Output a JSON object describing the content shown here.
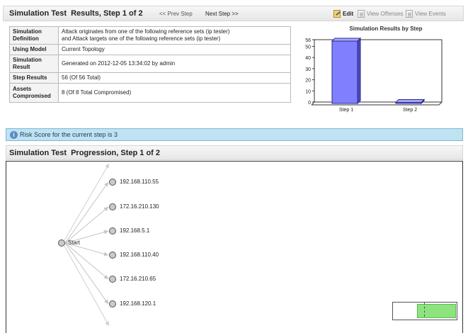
{
  "header": {
    "title": "Simulation Test",
    "subtitle": "Results, Step 1 of 2",
    "prev_step": "<< Prev Step",
    "next_step": "Next Step >>",
    "edit": "Edit",
    "view_offenses": "View Offenses",
    "view_events": "View Events"
  },
  "info_table": {
    "rows": [
      {
        "label": "Simulation Definition",
        "value_line1": "Attack originates from one of the following reference sets (ip tester)",
        "value_line2": "and Attack targets one of the following reference sets (ip tester)"
      },
      {
        "label": "Using Model",
        "value_line1": "Current Topology"
      },
      {
        "label": "Simulation Result",
        "value_line1": "Generated on 2012-12-05 13:34:02 by admin"
      },
      {
        "label": "Step Results",
        "value_line1": "56 (Of 56 Total)"
      },
      {
        "label": "Assets Compromised",
        "value_line1": "8 (Of 8 Total Compromised)"
      }
    ]
  },
  "chart_data": {
    "type": "bar",
    "title": "Simulation Results by Step",
    "categories": [
      "Step 1",
      "Step 2"
    ],
    "values": [
      56,
      0
    ],
    "ylim": [
      0,
      56
    ],
    "yticks": [
      0,
      10,
      20,
      30,
      40,
      50,
      56
    ],
    "bar_color": "#8080ff",
    "grid": false
  },
  "risk": {
    "text": "Risk Score for the current step is 3"
  },
  "progression": {
    "title": "Simulation Test",
    "subtitle": "Progression, Step 1 of 2",
    "start_label": "Start",
    "nodes": [
      "192.168.110.55",
      "172.16.210.130",
      "192.168.5.1",
      "192.168.110.40",
      "172.16.210.65",
      "192.168.120.1"
    ]
  },
  "colors": {
    "accent_blue": "#bfe3f2",
    "minimap_view": "#8de47e"
  }
}
